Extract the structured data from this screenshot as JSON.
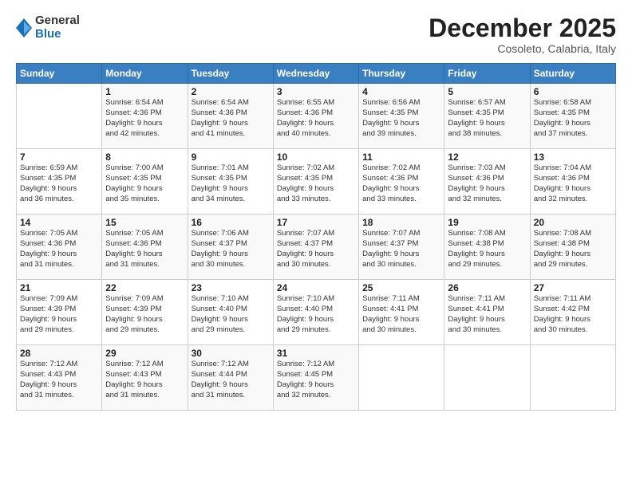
{
  "header": {
    "logo_general": "General",
    "logo_blue": "Blue",
    "month_title": "December 2025",
    "location": "Cosoleto, Calabria, Italy"
  },
  "days_of_week": [
    "Sunday",
    "Monday",
    "Tuesday",
    "Wednesday",
    "Thursday",
    "Friday",
    "Saturday"
  ],
  "weeks": [
    [
      {
        "day": "",
        "info": ""
      },
      {
        "day": "1",
        "info": "Sunrise: 6:54 AM\nSunset: 4:36 PM\nDaylight: 9 hours\nand 42 minutes."
      },
      {
        "day": "2",
        "info": "Sunrise: 6:54 AM\nSunset: 4:36 PM\nDaylight: 9 hours\nand 41 minutes."
      },
      {
        "day": "3",
        "info": "Sunrise: 6:55 AM\nSunset: 4:36 PM\nDaylight: 9 hours\nand 40 minutes."
      },
      {
        "day": "4",
        "info": "Sunrise: 6:56 AM\nSunset: 4:35 PM\nDaylight: 9 hours\nand 39 minutes."
      },
      {
        "day": "5",
        "info": "Sunrise: 6:57 AM\nSunset: 4:35 PM\nDaylight: 9 hours\nand 38 minutes."
      },
      {
        "day": "6",
        "info": "Sunrise: 6:58 AM\nSunset: 4:35 PM\nDaylight: 9 hours\nand 37 minutes."
      }
    ],
    [
      {
        "day": "7",
        "info": "Sunrise: 6:59 AM\nSunset: 4:35 PM\nDaylight: 9 hours\nand 36 minutes."
      },
      {
        "day": "8",
        "info": "Sunrise: 7:00 AM\nSunset: 4:35 PM\nDaylight: 9 hours\nand 35 minutes."
      },
      {
        "day": "9",
        "info": "Sunrise: 7:01 AM\nSunset: 4:35 PM\nDaylight: 9 hours\nand 34 minutes."
      },
      {
        "day": "10",
        "info": "Sunrise: 7:02 AM\nSunset: 4:35 PM\nDaylight: 9 hours\nand 33 minutes."
      },
      {
        "day": "11",
        "info": "Sunrise: 7:02 AM\nSunset: 4:36 PM\nDaylight: 9 hours\nand 33 minutes."
      },
      {
        "day": "12",
        "info": "Sunrise: 7:03 AM\nSunset: 4:36 PM\nDaylight: 9 hours\nand 32 minutes."
      },
      {
        "day": "13",
        "info": "Sunrise: 7:04 AM\nSunset: 4:36 PM\nDaylight: 9 hours\nand 32 minutes."
      }
    ],
    [
      {
        "day": "14",
        "info": "Sunrise: 7:05 AM\nSunset: 4:36 PM\nDaylight: 9 hours\nand 31 minutes."
      },
      {
        "day": "15",
        "info": "Sunrise: 7:05 AM\nSunset: 4:36 PM\nDaylight: 9 hours\nand 31 minutes."
      },
      {
        "day": "16",
        "info": "Sunrise: 7:06 AM\nSunset: 4:37 PM\nDaylight: 9 hours\nand 30 minutes."
      },
      {
        "day": "17",
        "info": "Sunrise: 7:07 AM\nSunset: 4:37 PM\nDaylight: 9 hours\nand 30 minutes."
      },
      {
        "day": "18",
        "info": "Sunrise: 7:07 AM\nSunset: 4:37 PM\nDaylight: 9 hours\nand 30 minutes."
      },
      {
        "day": "19",
        "info": "Sunrise: 7:08 AM\nSunset: 4:38 PM\nDaylight: 9 hours\nand 29 minutes."
      },
      {
        "day": "20",
        "info": "Sunrise: 7:08 AM\nSunset: 4:38 PM\nDaylight: 9 hours\nand 29 minutes."
      }
    ],
    [
      {
        "day": "21",
        "info": "Sunrise: 7:09 AM\nSunset: 4:39 PM\nDaylight: 9 hours\nand 29 minutes."
      },
      {
        "day": "22",
        "info": "Sunrise: 7:09 AM\nSunset: 4:39 PM\nDaylight: 9 hours\nand 29 minutes."
      },
      {
        "day": "23",
        "info": "Sunrise: 7:10 AM\nSunset: 4:40 PM\nDaylight: 9 hours\nand 29 minutes."
      },
      {
        "day": "24",
        "info": "Sunrise: 7:10 AM\nSunset: 4:40 PM\nDaylight: 9 hours\nand 29 minutes."
      },
      {
        "day": "25",
        "info": "Sunrise: 7:11 AM\nSunset: 4:41 PM\nDaylight: 9 hours\nand 30 minutes."
      },
      {
        "day": "26",
        "info": "Sunrise: 7:11 AM\nSunset: 4:41 PM\nDaylight: 9 hours\nand 30 minutes."
      },
      {
        "day": "27",
        "info": "Sunrise: 7:11 AM\nSunset: 4:42 PM\nDaylight: 9 hours\nand 30 minutes."
      }
    ],
    [
      {
        "day": "28",
        "info": "Sunrise: 7:12 AM\nSunset: 4:43 PM\nDaylight: 9 hours\nand 31 minutes."
      },
      {
        "day": "29",
        "info": "Sunrise: 7:12 AM\nSunset: 4:43 PM\nDaylight: 9 hours\nand 31 minutes."
      },
      {
        "day": "30",
        "info": "Sunrise: 7:12 AM\nSunset: 4:44 PM\nDaylight: 9 hours\nand 31 minutes."
      },
      {
        "day": "31",
        "info": "Sunrise: 7:12 AM\nSunset: 4:45 PM\nDaylight: 9 hours\nand 32 minutes."
      },
      {
        "day": "",
        "info": ""
      },
      {
        "day": "",
        "info": ""
      },
      {
        "day": "",
        "info": ""
      }
    ]
  ]
}
